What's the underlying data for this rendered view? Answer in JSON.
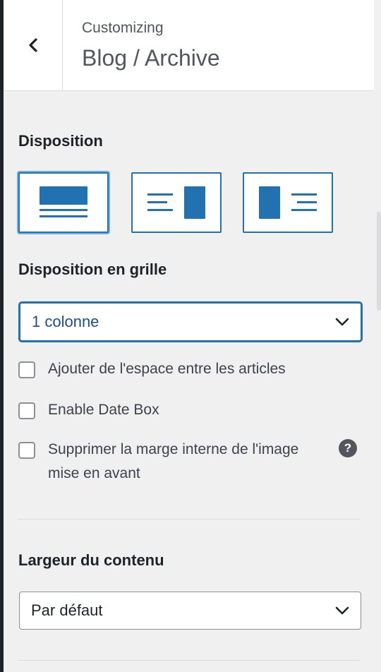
{
  "header": {
    "back_icon": "chevron-left-icon",
    "customizing": "Customizing",
    "title": "Blog / Archive"
  },
  "disposition": {
    "label": "Disposition",
    "options": [
      {
        "name": "full-width",
        "selected": true
      },
      {
        "name": "right-sidebar",
        "selected": false
      },
      {
        "name": "left-sidebar",
        "selected": false
      }
    ],
    "accent_color": "#2271b1"
  },
  "grid": {
    "label": "Disposition en grille",
    "selected": "1 colonne"
  },
  "checkboxes": [
    {
      "label": "Ajouter de l'espace entre les articles",
      "checked": false
    },
    {
      "label": "Enable Date Box",
      "checked": false
    },
    {
      "label": "Supprimer la marge interne de l'image mise en avant",
      "checked": false
    }
  ],
  "help_icon": "?",
  "content_width": {
    "label": "Largeur du contenu",
    "selected": "Par défaut"
  }
}
